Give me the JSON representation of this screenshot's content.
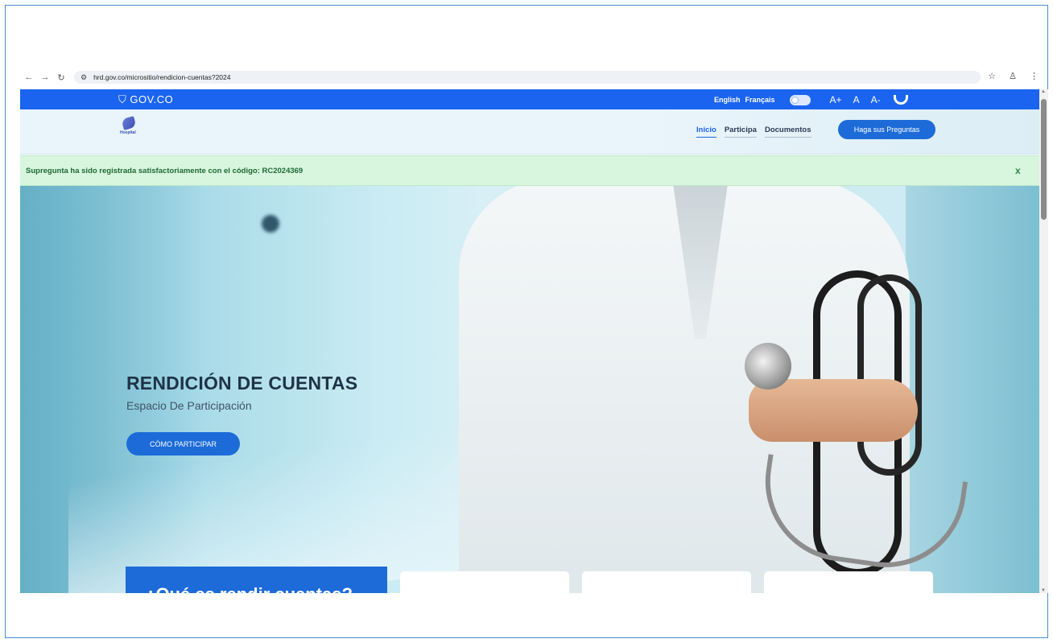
{
  "browser": {
    "url": "hrd.gov.co/micrositio/rendicion-cuentas?2024",
    "icons": [
      "back-icon",
      "forward-icon",
      "reload-icon",
      "site-info-icon",
      "star-icon",
      "profile-icon",
      "more-icon"
    ]
  },
  "gov_bar": {
    "logo": "GOV.CO",
    "languages": [
      "English",
      "Français"
    ],
    "font_controls": [
      "A+",
      "A",
      "A-"
    ]
  },
  "header": {
    "logo_text": "Hospital",
    "nav": [
      "Inicio",
      "Participa",
      "Documentos"
    ],
    "cta": "Haga sus Preguntas"
  },
  "alert": {
    "message": "Supregunta ha sido registrada satisfactoriamente con el código: RC2024369",
    "close": "x"
  },
  "hero": {
    "title": "RENDICIÓN DE CUENTAS",
    "subtitle": "Espacio De Participación",
    "button": "CÓMO PARTICIPAR",
    "question": "¿Qué es rendir cuentas?"
  },
  "colors": {
    "gov_blue": "#1a64f0",
    "primary": "#1c6bd8",
    "alert_bg": "#d8f5de",
    "alert_text": "#1d6b32"
  }
}
